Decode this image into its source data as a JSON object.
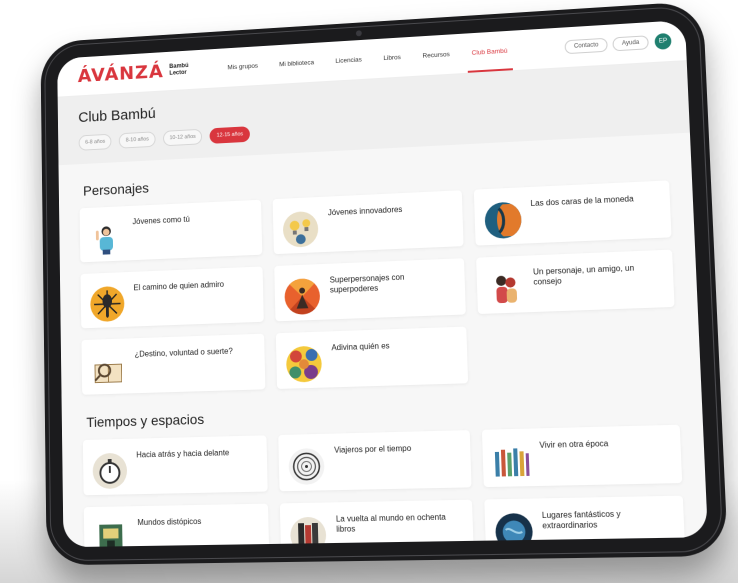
{
  "header": {
    "brand": "ÁVÁNZÁ",
    "brand_sub_1": "Bambú",
    "brand_sub_2": "Lector",
    "nav": [
      "Mis grupos",
      "Mi biblioteca",
      "Licencias",
      "Libros",
      "Recursos",
      "Club Bambú"
    ],
    "active_nav": "Club Bambú",
    "buttons": [
      "Contacto",
      "Ayuda"
    ],
    "avatar_initials": "EP"
  },
  "page": {
    "title": "Club Bambú",
    "filters": [
      "6-8 años",
      "8-10 años",
      "10-12 años",
      "12-15 años"
    ],
    "active_filter": "12-15 años"
  },
  "sections": [
    {
      "title": "Personajes",
      "cards": [
        {
          "label": "Jóvenes como tú",
          "icon": "girl-waving-icon"
        },
        {
          "label": "Jóvenes innovadores",
          "icon": "lightbulbs-icon"
        },
        {
          "label": "Las dos caras de la moneda",
          "icon": "two-faces-icon"
        },
        {
          "label": "El camino de quien admiro",
          "icon": "microphone-icon"
        },
        {
          "label": "Superpersonajes con superpoderes",
          "icon": "superhero-icon"
        },
        {
          "label": "Un personaje, un amigo, un consejo",
          "icon": "friends-icon"
        },
        {
          "label": "¿Destino, voluntad o suerte?",
          "icon": "book-magnifier-icon"
        },
        {
          "label": "Adivina quién es",
          "icon": "mosaic-faces-icon"
        }
      ]
    },
    {
      "title": "Tiempos y espacios",
      "cards": [
        {
          "label": "Hacia atrás y hacia delante",
          "icon": "stopwatch-icon"
        },
        {
          "label": "Viajeros por el tiempo",
          "icon": "spiral-clock-icon"
        },
        {
          "label": "Vivir en otra época",
          "icon": "crowd-icon"
        },
        {
          "label": "Mundos distópicos",
          "icon": "dystopia-icon"
        },
        {
          "label": "La vuelta al mundo en ochenta libros",
          "icon": "books-globe-icon"
        },
        {
          "label": "Lugares fantásticos y extraordinarios",
          "icon": "planet-icon"
        }
      ]
    }
  ],
  "colors": {
    "accent": "#d9363e",
    "avatar": "#1f7f6f",
    "background": "#f7f7f7"
  }
}
